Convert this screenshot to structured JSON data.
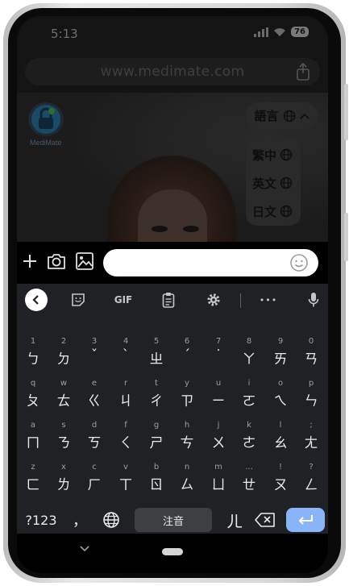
{
  "status_bar": {
    "time": "5:13",
    "battery": "76"
  },
  "browser": {
    "url": "www.medimate.com"
  },
  "page": {
    "logo_text": "MediMate",
    "language_button": {
      "label": "語言"
    },
    "language_options": [
      {
        "label": "繁中"
      },
      {
        "label": "英文"
      },
      {
        "label": "日文"
      }
    ]
  },
  "chat": {
    "input_value": "",
    "input_placeholder": ""
  },
  "keyboard": {
    "toolbar": {
      "gif_label": "GIF",
      "more_label": "•••"
    },
    "rows": [
      {
        "hints": [
          "1",
          "2",
          "3",
          "4",
          "5",
          "6",
          "7",
          "8",
          "9",
          "0"
        ],
        "keys": [
          "ㄅ",
          "ㄉ",
          "ˇ",
          "ˋ",
          "ㄓ",
          "ˊ",
          "˙",
          "ㄚ",
          "ㄞ",
          "ㄢ"
        ]
      },
      {
        "hints": [
          "q",
          "w",
          "e",
          "r",
          "t",
          "y",
          "u",
          "i",
          "o",
          "p"
        ],
        "keys": [
          "ㄆ",
          "ㄊ",
          "ㄍ",
          "ㄐ",
          "ㄔ",
          "ㄗ",
          "ㄧ",
          "ㄛ",
          "ㄟ",
          "ㄣ"
        ]
      },
      {
        "hints": [
          "a",
          "s",
          "d",
          "f",
          "g",
          "h",
          "j",
          "k",
          "l",
          ";"
        ],
        "keys": [
          "ㄇ",
          "ㄋ",
          "ㄎ",
          "ㄑ",
          "ㄕ",
          "ㄘ",
          "ㄨ",
          "ㄜ",
          "ㄠ",
          "ㄤ"
        ]
      },
      {
        "hints": [
          "z",
          "x",
          "c",
          "v",
          "b",
          "n",
          "m",
          "...",
          "!",
          "?"
        ],
        "keys": [
          "ㄈ",
          "ㄌ",
          "ㄏ",
          "ㄒ",
          "ㄖ",
          "ㄙ",
          "ㄩ",
          "ㄝ",
          "ㄡ",
          "ㄥ"
        ]
      }
    ],
    "bottom": {
      "symbols_label": "?123",
      "comma_label": "，",
      "space_label": "注音",
      "er_label": "ㄦ"
    }
  },
  "colors": {
    "accent": "#8ab4f8",
    "keyboard_bg": "#202124",
    "key_text": "#e8eaed"
  }
}
